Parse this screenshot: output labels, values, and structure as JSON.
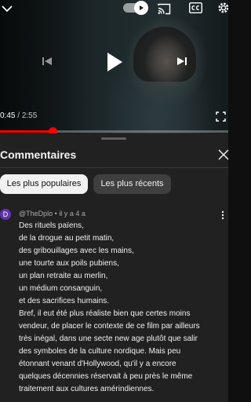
{
  "player": {
    "current_time": "0:45",
    "separator": " / ",
    "duration": "2:55",
    "progress_fraction": 0.23,
    "icons": {
      "collapse": "chevron-down-icon",
      "autoplay": "autoplay-toggle",
      "cast": "cast-icon",
      "captions": "captions-icon",
      "settings": "gear-icon",
      "previous": "previous-icon",
      "play": "play-icon",
      "next": "next-icon",
      "fullscreen": "fullscreen-icon"
    },
    "accent_color": "#ff0000"
  },
  "comments": {
    "title": "Commentaires",
    "filters": {
      "popular": "Les plus populaires",
      "recent": "Les plus récents"
    },
    "items": [
      {
        "avatar_letter": "D",
        "avatar_color": "#5e35b1",
        "author": "@TheDplo",
        "dot": " • ",
        "age": "il y a 4 a",
        "lines": [
          "Des rituels païens,",
          "de la drogue au petit matin,",
          "des gribouillages avec les mains,",
          "une tourte aux poils pubiens,",
          "un plan retraite au merlin,",
          "un médium consanguin,",
          "et des sacrifices humains.",
          "Bref, il eut été plus réaliste bien que certes moins",
          "vendeur, de placer le contexte de ce film par ailleurs",
          "très inégal, dans une secte new age plutôt que salir",
          "des symboles de la culture nordique. Mais peu",
          "étonnant venant d'Hollywood, qu'il y a encore",
          "quelques décennies réservait à peu près le même",
          "traitement aux cultures amérindiennes."
        ]
      }
    ]
  }
}
